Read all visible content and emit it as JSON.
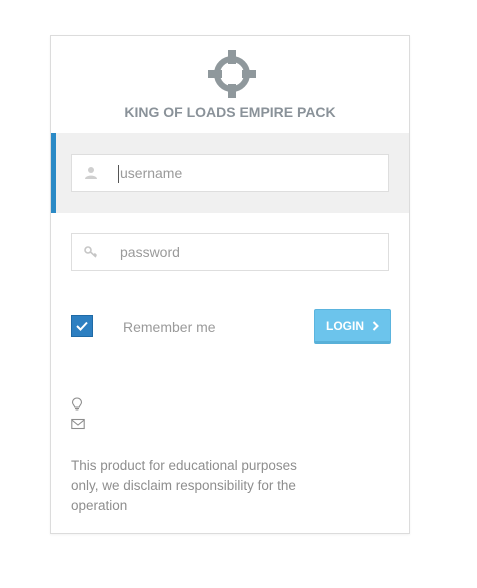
{
  "app": {
    "title": "KING OF LOADS EMPIRE PACK"
  },
  "login": {
    "username_placeholder": "username",
    "password_placeholder": "password",
    "remember_label": "Remember me",
    "remember_checked": true,
    "login_label": "LOGIN"
  },
  "footer": {
    "disclaimer": "This product for educational purposes only, we disclaim responsibility for the operation"
  },
  "icons": [
    "crosshair-logo-icon",
    "user-icon",
    "key-icon",
    "checkmark-icon",
    "chevron-right-icon",
    "lightbulb-icon",
    "envelope-icon"
  ],
  "colors": {
    "accent": "#2b8ac6",
    "button": "#6cc4ec",
    "brand_text": "#8a9299"
  }
}
